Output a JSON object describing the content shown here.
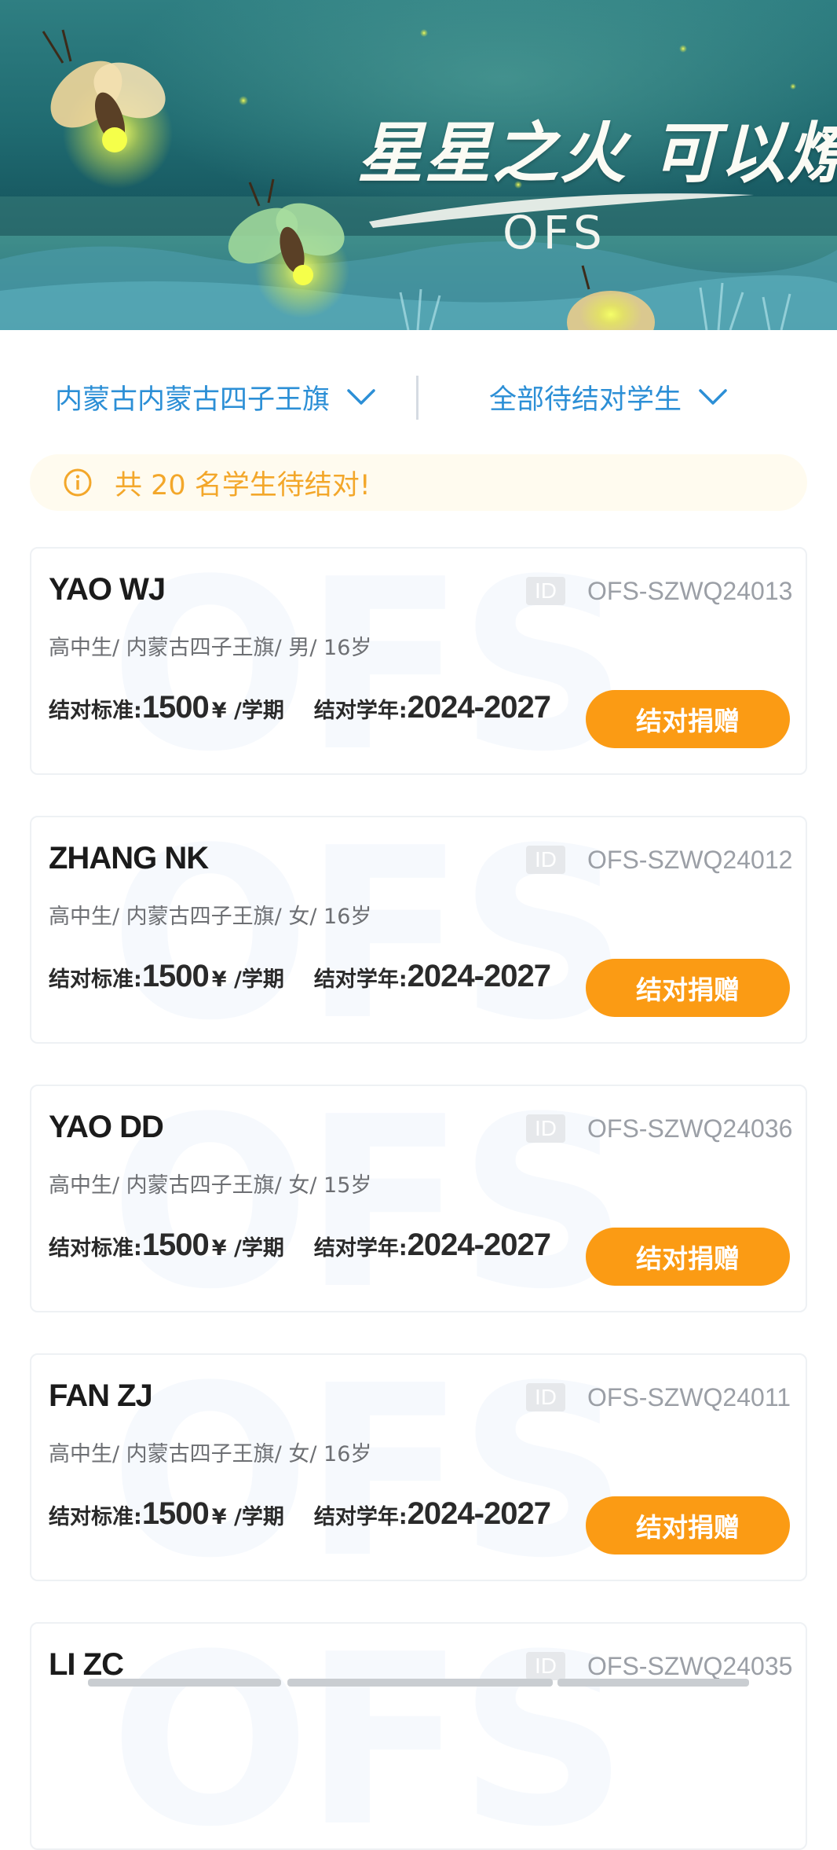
{
  "banner": {
    "slogan": "星星之火 可以燎原",
    "brand": "OFS"
  },
  "filters": {
    "region": "内蒙古内蒙古四子王旗",
    "status": "全部待结对学生"
  },
  "notice": {
    "text": "共 20 名学生待结对!"
  },
  "card_labels": {
    "id_tag": "ID",
    "standard_label": "结对标准:",
    "unit": "¥ /学期",
    "year_label": "结对学年:",
    "button": "结对捐赠",
    "watermark": "OFS"
  },
  "students": [
    {
      "name": "YAO WJ",
      "id": "OFS-SZWQ24013",
      "meta": "高中生/ 内蒙古四子王旗/ 男/ 16岁",
      "standard": "1500",
      "years": "2024-2027"
    },
    {
      "name": "ZHANG NK",
      "id": "OFS-SZWQ24012",
      "meta": "高中生/ 内蒙古四子王旗/ 女/ 16岁",
      "standard": "1500",
      "years": "2024-2027"
    },
    {
      "name": "YAO DD",
      "id": "OFS-SZWQ24036",
      "meta": "高中生/ 内蒙古四子王旗/ 女/ 15岁",
      "standard": "1500",
      "years": "2024-2027"
    },
    {
      "name": "FAN ZJ",
      "id": "OFS-SZWQ24011",
      "meta": "高中生/ 内蒙古四子王旗/ 女/ 16岁",
      "standard": "1500",
      "years": "2024-2027"
    },
    {
      "name": "LI ZC",
      "id": "OFS-SZWQ24035",
      "meta": "",
      "standard": "",
      "years": ""
    }
  ]
}
